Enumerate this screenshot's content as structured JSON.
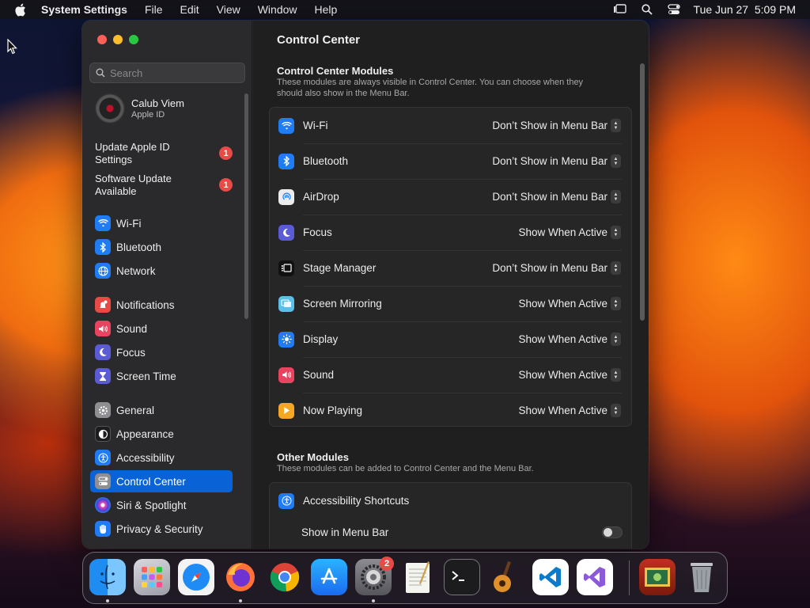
{
  "menubar": {
    "app_name": "System Settings",
    "menus": [
      "File",
      "Edit",
      "View",
      "Window",
      "Help"
    ],
    "clock": "Tue Jun 27  5:09 PM"
  },
  "sidebar": {
    "search_placeholder": "Search",
    "profile": {
      "name": "Calub Viem",
      "subtitle": "Apple ID"
    },
    "alerts": [
      {
        "label": "Update Apple ID Settings",
        "badge": "1"
      },
      {
        "label": "Software Update Available",
        "badge": "1"
      }
    ],
    "items": [
      {
        "label": "Wi-Fi",
        "icon": "wifi-icon",
        "color": "#1f7cf5"
      },
      {
        "label": "Bluetooth",
        "icon": "bluetooth-icon",
        "color": "#1f7cf5"
      },
      {
        "label": "Network",
        "icon": "globe-icon",
        "color": "#1f7cf5"
      },
      {
        "label": "Notifications",
        "icon": "bell-icon",
        "color": "#e94a45"
      },
      {
        "label": "Sound",
        "icon": "speaker-icon",
        "color": "#e9445f"
      },
      {
        "label": "Focus",
        "icon": "moon-icon",
        "color": "#5b5bd6"
      },
      {
        "label": "Screen Time",
        "icon": "hourglass-icon",
        "color": "#5b5bd6"
      },
      {
        "label": "General",
        "icon": "gear-icon",
        "color": "#8e8e93"
      },
      {
        "label": "Appearance",
        "icon": "appearance-icon",
        "color": "#1c1c1e"
      },
      {
        "label": "Accessibility",
        "icon": "accessibility-icon",
        "color": "#1f7cf5"
      },
      {
        "label": "Control Center",
        "icon": "control-center-icon",
        "color": "#8e8e93",
        "selected": true
      },
      {
        "label": "Siri & Spotlight",
        "icon": "siri-icon",
        "color": "#b3489b"
      },
      {
        "label": "Privacy & Security",
        "icon": "hand-icon",
        "color": "#1f7cf5"
      }
    ]
  },
  "content": {
    "title": "Control Center",
    "modules_section": {
      "title": "Control Center Modules",
      "description": "These modules are always visible in Control Center. You can choose when they should also show in the Menu Bar.",
      "rows": [
        {
          "label": "Wi-Fi",
          "value": "Don’t Show in Menu Bar",
          "icon": "wifi-icon",
          "color": "#1f7cf5"
        },
        {
          "label": "Bluetooth",
          "value": "Don’t Show in Menu Bar",
          "icon": "bluetooth-icon",
          "color": "#1f7cf5"
        },
        {
          "label": "AirDrop",
          "value": "Don’t Show in Menu Bar",
          "icon": "airdrop-icon",
          "color": "#2b2b2e"
        },
        {
          "label": "Focus",
          "value": "Show When Active",
          "icon": "moon-icon",
          "color": "#5b5bd6"
        },
        {
          "label": "Stage Manager",
          "value": "Don’t Show in Menu Bar",
          "icon": "stage-manager-icon",
          "color": "#111111"
        },
        {
          "label": "Screen Mirroring",
          "value": "Show When Active",
          "icon": "screen-mirroring-icon",
          "color": "#38a8d8"
        },
        {
          "label": "Display",
          "value": "Show When Active",
          "icon": "sun-icon",
          "color": "#1f7cf5"
        },
        {
          "label": "Sound",
          "value": "Show When Active",
          "icon": "speaker-icon",
          "color": "#e9445f"
        },
        {
          "label": "Now Playing",
          "value": "Show When Active",
          "icon": "play-icon",
          "color": "#f5a623"
        }
      ]
    },
    "other_section": {
      "title": "Other Modules",
      "description": "These modules can be added to Control Center and the Menu Bar.",
      "rows": [
        {
          "label": "Accessibility Shortcuts",
          "icon": "accessibility-icon",
          "color": "#1f7cf5"
        },
        {
          "label": "Show in Menu Bar",
          "toggle": false
        }
      ]
    }
  },
  "dock": {
    "apps": [
      "Finder",
      "Launchpad",
      "Safari",
      "Firefox",
      "Chrome",
      "App Store",
      "System Settings",
      "TextEdit",
      "Terminal",
      "GarageBand",
      "Visual Studio Code",
      "Visual Studio",
      "Photo Booth",
      "Trash"
    ],
    "badges": {
      "System Settings": "2"
    }
  }
}
